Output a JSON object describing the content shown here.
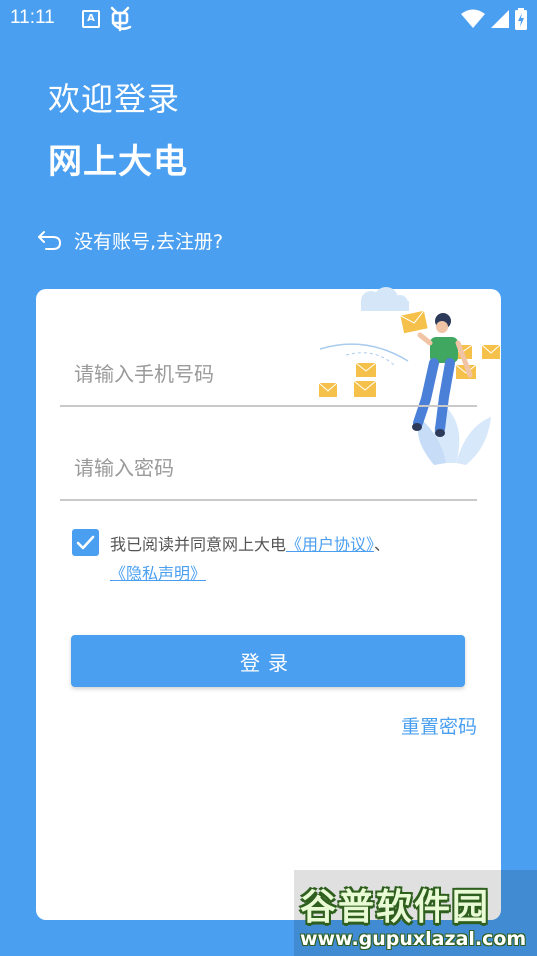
{
  "status_bar": {
    "time": "11:11",
    "notif_a": "A"
  },
  "header": {
    "welcome": "欢迎登录",
    "brand": "网上大电"
  },
  "register": {
    "label": "没有账号,去注册?"
  },
  "form": {
    "phone_placeholder": "请输入手机号码",
    "password_placeholder": "请输入密码",
    "agreement": {
      "checked": true,
      "prefix": "我已阅读并同意网上大电",
      "user_link": "《用户协议》",
      "separator": "、",
      "privacy_link": "《隐私声明》"
    },
    "login_label": "登录",
    "reset_label": "重置密码"
  },
  "colors": {
    "primary": "#4a9ff0",
    "card": "#ffffff",
    "hint": "#9a9a9a"
  },
  "watermark": {
    "brand": "谷普软件园",
    "url": "www.gupuxlazal.com"
  }
}
